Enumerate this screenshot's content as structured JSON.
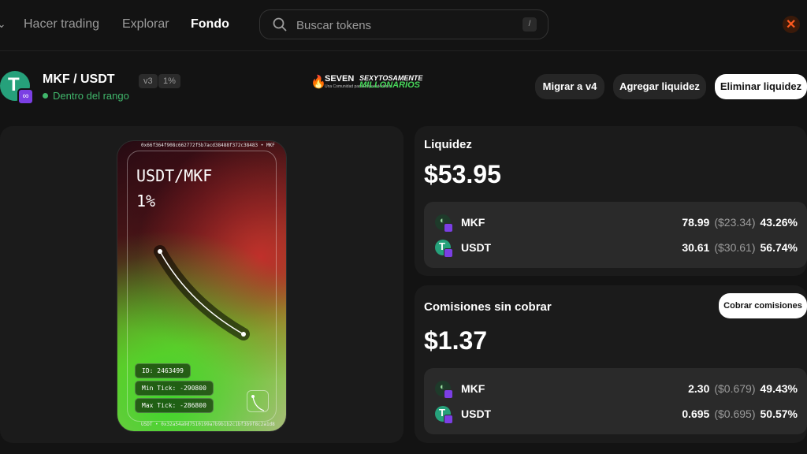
{
  "nav": {
    "items": [
      {
        "label": "Hacer trading",
        "active": false
      },
      {
        "label": "Explorar",
        "active": false
      },
      {
        "label": "Fondo",
        "active": true
      }
    ],
    "search_placeholder": "Buscar tokens",
    "search_shortcut": "/",
    "corner_icon": "x-close-icon"
  },
  "pair": {
    "title": "MKF / USDT",
    "status": "Dentro del rango",
    "status_color": "#40b66b",
    "badges": [
      "v3",
      "1%"
    ]
  },
  "logo": {
    "brand": "SEVEN",
    "tagline": "Una Comunidad para Emprendedores",
    "line1": "SEXYTOSAMENTE",
    "line2": "MILLONARIOS"
  },
  "actions": {
    "migrate": "Migrar a v4",
    "add": "Agregar liquidez",
    "remove": "Eliminar liquidez"
  },
  "nft": {
    "pair_label": "USDT/MKF",
    "fee_label": "1%",
    "hash_top": "0x66f364f908c662772f5b7acd38488f372c38483 • MKF",
    "hash_bottom": "USDT • 0x32a54a9d7510199a7b9b1b2c1bf3b9f8c2a1d8",
    "id_label": "ID: 2463499",
    "min_tick": "Min Tick: -290800",
    "max_tick": "Max Tick: -286800"
  },
  "liquidity": {
    "label": "Liquidez",
    "total": "$53.95",
    "tokens": [
      {
        "name": "MKF",
        "amount": "78.99",
        "usd": "($23.34)",
        "pct": "43.26%"
      },
      {
        "name": "USDT",
        "amount": "30.61",
        "usd": "($30.61)",
        "pct": "56.74%"
      }
    ]
  },
  "fees": {
    "label": "Comisiones sin cobrar",
    "total": "$1.37",
    "collect_button": "Cobrar comisiones",
    "tokens": [
      {
        "name": "MKF",
        "amount": "2.30",
        "usd": "($0.679)",
        "pct": "49.43%"
      },
      {
        "name": "USDT",
        "amount": "0.695",
        "usd": "($0.695)",
        "pct": "50.57%"
      }
    ]
  }
}
